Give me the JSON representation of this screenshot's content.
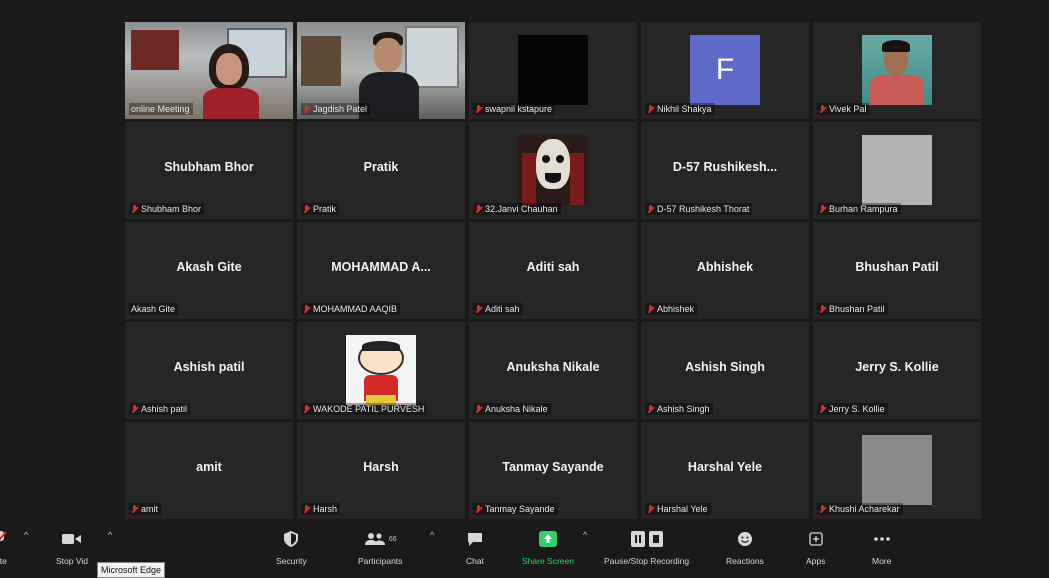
{
  "tiles": [
    {
      "label": "online Meeting",
      "type": "video-woman",
      "speaking": true,
      "muted": false
    },
    {
      "label": "Jagdish Patel",
      "type": "video-man",
      "muted": true
    },
    {
      "label": "swapnil kstapure",
      "type": "black",
      "muted": true
    },
    {
      "label": "Nikhil Shakya",
      "type": "initial",
      "initial": "F",
      "muted": true
    },
    {
      "label": "Vivek Pal",
      "type": "selfie",
      "muted": true
    },
    {
      "name": "Shubham Bhor",
      "label": "Shubham Bhor",
      "muted": true
    },
    {
      "name": "Pratik",
      "label": "Pratik",
      "muted": true
    },
    {
      "label": "32.Janvi Chauhan",
      "type": "mask",
      "muted": true
    },
    {
      "name": "D-57 Rushikesh...",
      "label": "D-57 Rushikesh Thorat",
      "muted": true
    },
    {
      "label": "Burhan Rampura",
      "type": "gray",
      "muted": true
    },
    {
      "name": "Akash Gite",
      "label": "Akash Gite",
      "muted": false
    },
    {
      "name": "MOHAMMAD A...",
      "label": "MOHAMMAD AAQIB",
      "muted": true
    },
    {
      "name": "Aditi sah",
      "label": "Aditi sah",
      "muted": true
    },
    {
      "name": "Abhishek",
      "label": "Abhishek",
      "muted": true
    },
    {
      "name": "Bhushan Patil",
      "label": "Bhushan Patil",
      "muted": true
    },
    {
      "name": "Ashish patil",
      "label": "Ashish patil",
      "muted": true
    },
    {
      "label": "WAKODE PATIL PURVESH",
      "type": "cartoon",
      "muted": true
    },
    {
      "name": "Anuksha Nikale",
      "label": "Anuksha Nikale",
      "muted": true
    },
    {
      "name": "Ashish Singh",
      "label": "Ashish Singh",
      "muted": true
    },
    {
      "name": "Jerry S. Kollie",
      "label": "Jerry S. Kollie",
      "muted": true
    },
    {
      "name": "amit",
      "label": "amit",
      "muted": true
    },
    {
      "name": "Harsh",
      "label": "Harsh",
      "muted": true
    },
    {
      "name": "Tanmay Sayande",
      "label": "Tanmay Sayande",
      "muted": true
    },
    {
      "name": "Harshal Yele",
      "label": "Harshal Yele",
      "muted": true
    },
    {
      "label": "Khushi Acharekar",
      "type": "gray-dark",
      "muted": true
    }
  ],
  "toolbar": {
    "unmute_label": "ute",
    "stop_video_label": "Stop Vid",
    "security_label": "Security",
    "participants_label": "Participants",
    "participants_count": "66",
    "chat_label": "Chat",
    "share_label": "Share Screen",
    "record_label": "Pause/Stop Recording",
    "reactions_label": "Reactions",
    "apps_label": "Apps",
    "more_label": "More"
  },
  "tooltip": "Microsoft Edge",
  "colors": {
    "background": "#1a1a1a",
    "tile": "#262626",
    "active_speaker": "#c8e35a",
    "share_green": "#2fd16a",
    "muted_red": "#e02828"
  }
}
